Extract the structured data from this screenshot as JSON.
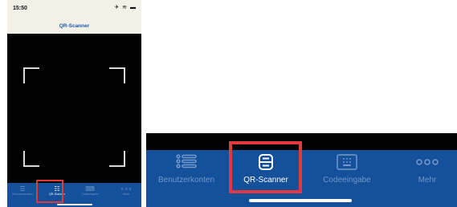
{
  "status": {
    "time": "15:50",
    "icons": [
      "airplane-icon",
      "wifi-icon",
      "battery-icon"
    ]
  },
  "header": {
    "title": "QR-Scanner"
  },
  "tabs": [
    {
      "label": "Benutzerkonten",
      "icon": "list-icon",
      "active": false
    },
    {
      "label": "QR-Scanner",
      "icon": "scanner-icon",
      "active": true
    },
    {
      "label": "Codeeingabe",
      "icon": "keypad-icon",
      "active": false
    },
    {
      "label": "Mehr",
      "icon": "more-icon",
      "active": false
    }
  ],
  "colors": {
    "tabbar": "#15509b",
    "highlight": "#e0393e",
    "inactive": "#7397c9",
    "active": "#ffffff"
  }
}
